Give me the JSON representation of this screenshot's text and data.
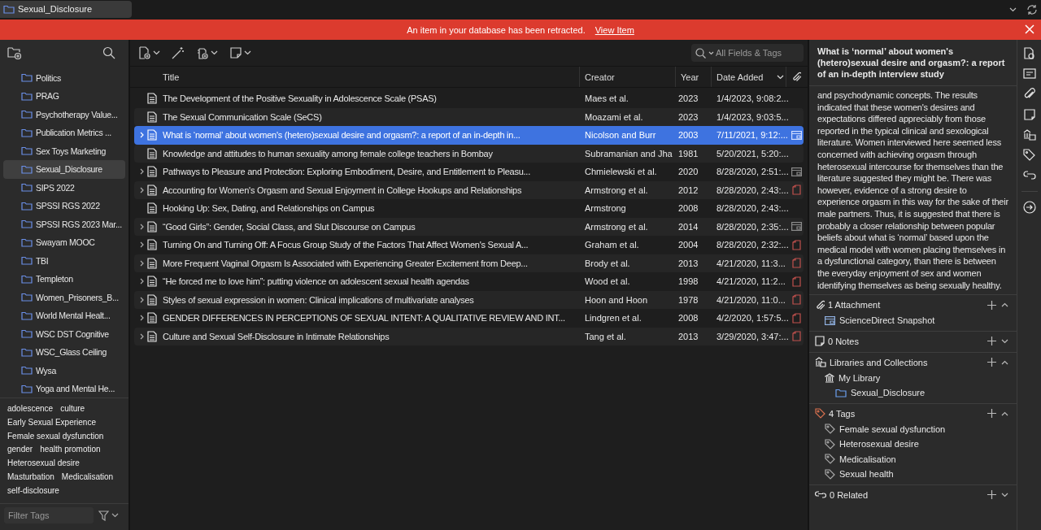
{
  "tab": {
    "title": "Sexual_Disclosure"
  },
  "banner": {
    "message": "An item in your database has been retracted.",
    "link": "View Item"
  },
  "collections": [
    {
      "name": "Politics",
      "selected": false
    },
    {
      "name": "PRAG",
      "selected": false
    },
    {
      "name": "Psychotherapy Value...",
      "selected": false
    },
    {
      "name": "Publication Metrics ...",
      "selected": false
    },
    {
      "name": "Sex Toys Marketing",
      "selected": false
    },
    {
      "name": "Sexual_Disclosure",
      "selected": true
    },
    {
      "name": "SIPS 2022",
      "selected": false
    },
    {
      "name": "SPSSI RGS 2022",
      "selected": false
    },
    {
      "name": "SPSSI RGS 2023 Mar...",
      "selected": false
    },
    {
      "name": "Swayam MOOC",
      "selected": false
    },
    {
      "name": "TBI",
      "selected": false
    },
    {
      "name": "Templeton",
      "selected": false
    },
    {
      "name": "Women_Prisoners_B...",
      "selected": false
    },
    {
      "name": "World Mental Healt...",
      "selected": false
    },
    {
      "name": "WSC DST Cognitive",
      "selected": false
    },
    {
      "name": "WSC_Glass Ceiling",
      "selected": false
    },
    {
      "name": "Wysa",
      "selected": false
    },
    {
      "name": "Yoga and Mental He...",
      "selected": false
    }
  ],
  "tags": [
    "adolescence",
    "culture",
    "Early Sexual Experience",
    "Female sexual dysfunction",
    "gender",
    "health promotion",
    "Heterosexual desire",
    "Masturbation",
    "Medicalisation",
    "self-disclosure"
  ],
  "tag_filter": {
    "placeholder": "Filter Tags"
  },
  "search": {
    "placeholder": "All Fields & Tags"
  },
  "table": {
    "columns": [
      {
        "label": "Title",
        "sorted": false
      },
      {
        "label": "Creator",
        "sorted": false
      },
      {
        "label": "Year",
        "sorted": false
      },
      {
        "label": "Date Added",
        "sorted": true
      }
    ],
    "rows": [
      {
        "title": "The Development of the Positive Sexuality in Adolescence Scale (PSAS)",
        "creator": "Maes et al.",
        "year": "2023",
        "date_added": "1/4/2023, 9:08:2...",
        "has_children": false,
        "kind": "none",
        "selected": false
      },
      {
        "title": "The Sexual Communication Scale (SeCS)",
        "creator": "Moazami et al.",
        "year": "2023",
        "date_added": "1/4/2023, 9:03:5...",
        "has_children": false,
        "kind": "none",
        "selected": false
      },
      {
        "title": "What is ‘normal’ about women's (hetero)sexual desire and orgasm?: a report of an in-depth in...",
        "creator": "Nicolson and Burr",
        "year": "2003",
        "date_added": "7/11/2021, 9:12:...",
        "has_children": true,
        "kind": "snapshot",
        "selected": true
      },
      {
        "title": "Knowledge and attitudes to human sexuality among female college teachers in Bombay",
        "creator": "Subramanian and Jha",
        "year": "1981",
        "date_added": "5/20/2021, 5:20:...",
        "has_children": false,
        "kind": "none",
        "selected": false
      },
      {
        "title": "Pathways to Pleasure and Protection: Exploring Embodiment, Desire, and Entitlement to Pleasu...",
        "creator": "Chmielewski et al.",
        "year": "2020",
        "date_added": "8/28/2020, 2:51:...",
        "has_children": true,
        "kind": "snapshot",
        "selected": false
      },
      {
        "title": "Accounting for Women's Orgasm and Sexual Enjoyment in College Hookups and Relationships",
        "creator": "Armstrong et al.",
        "year": "2012",
        "date_added": "8/28/2020, 2:43:...",
        "has_children": true,
        "kind": "pdf",
        "selected": false
      },
      {
        "title": "Hooking Up: Sex, Dating, and Relationships on Campus",
        "creator": "Armstrong",
        "year": "2008",
        "date_added": "8/28/2020, 2:43:...",
        "has_children": false,
        "kind": "none",
        "selected": false
      },
      {
        "title": "“Good Girls”: Gender, Social Class, and Slut Discourse on Campus",
        "creator": "Armstrong et al.",
        "year": "2014",
        "date_added": "8/28/2020, 2:35:...",
        "has_children": true,
        "kind": "snapshot",
        "selected": false
      },
      {
        "title": "Turning On and Turning Off: A Focus Group Study of the Factors That Affect Women's Sexual A...",
        "creator": "Graham et al.",
        "year": "2004",
        "date_added": "8/28/2020, 2:32:...",
        "has_children": true,
        "kind": "pdf",
        "selected": false
      },
      {
        "title": "More Frequent Vaginal Orgasm Is Associated with Experiencing Greater Excitement from Deep...",
        "creator": "Brody et al.",
        "year": "2013",
        "date_added": "4/21/2020, 11:3...",
        "has_children": true,
        "kind": "pdf",
        "selected": false
      },
      {
        "title": "“He forced me to love him”: putting violence on adolescent sexual health agendas",
        "creator": "Wood et al.",
        "year": "1998",
        "date_added": "4/21/2020, 11:2...",
        "has_children": true,
        "kind": "pdf",
        "selected": false
      },
      {
        "title": "Styles of sexual expression in women: Clinical implications of multivariate analyses",
        "creator": "Hoon and Hoon",
        "year": "1978",
        "date_added": "4/21/2020, 11:0...",
        "has_children": true,
        "kind": "pdf",
        "selected": false
      },
      {
        "title": "GENDER DIFFERENCES IN PERCEPTIONS OF SEXUAL INTENT: A QUALITATIVE REVIEW AND INT...",
        "creator": "Lindgren et al.",
        "year": "2008",
        "date_added": "4/2/2020, 1:57:5...",
        "has_children": true,
        "kind": "pdf",
        "selected": false
      },
      {
        "title": "Culture and Sexual Self-Disclosure in Intimate Relationships",
        "creator": "Tang et al.",
        "year": "2013",
        "date_added": "3/29/2020, 3:47:...",
        "has_children": true,
        "kind": "pdf",
        "selected": false
      }
    ]
  },
  "item_pane": {
    "title": "What is ‘normal’ about women's (hetero)sexual desire and orgasm?: a report of an in-depth interview study",
    "abstract": "and psychodynamic concepts. The results indicated that these women's desires and expectations differed appreciably from those reported in the typical clinical and sexological literature. Women interviewed here seemed less concerned with achieving orgasm through heterosexual intercourse for themselves than the literature suggested they might be. There was however, evidence of a strong desire to experience orgasm in this way for the sake of their male partners. Thus, it is suggested that there is probably a closer relationship between popular beliefs about what is ‘normal’ based upon the medical model with women placing themselves in a dysfunctional category, than there is between the everyday enjoyment of sex and women identifying themselves as being sexually healthy.",
    "sections": [
      {
        "kind": "attachments",
        "heading": "1 Attachment",
        "expanded": true,
        "entries": [
          {
            "label": "ScienceDirect Snapshot"
          }
        ]
      },
      {
        "kind": "notes",
        "heading": "0 Notes",
        "expanded": false
      },
      {
        "kind": "libraries",
        "heading": "Libraries and Collections",
        "expanded": true,
        "entries": [
          {
            "label": "My Library",
            "children": [
              {
                "label": "Sexual_Disclosure"
              }
            ]
          }
        ]
      },
      {
        "kind": "tags",
        "heading": "4 Tags",
        "expanded": true,
        "entries": [
          {
            "label": "Female sexual dysfunction"
          },
          {
            "label": "Heterosexual desire"
          },
          {
            "label": "Medicalisation"
          },
          {
            "label": "Sexual health"
          }
        ]
      },
      {
        "kind": "related",
        "heading": "0 Related",
        "expanded": false
      }
    ]
  }
}
